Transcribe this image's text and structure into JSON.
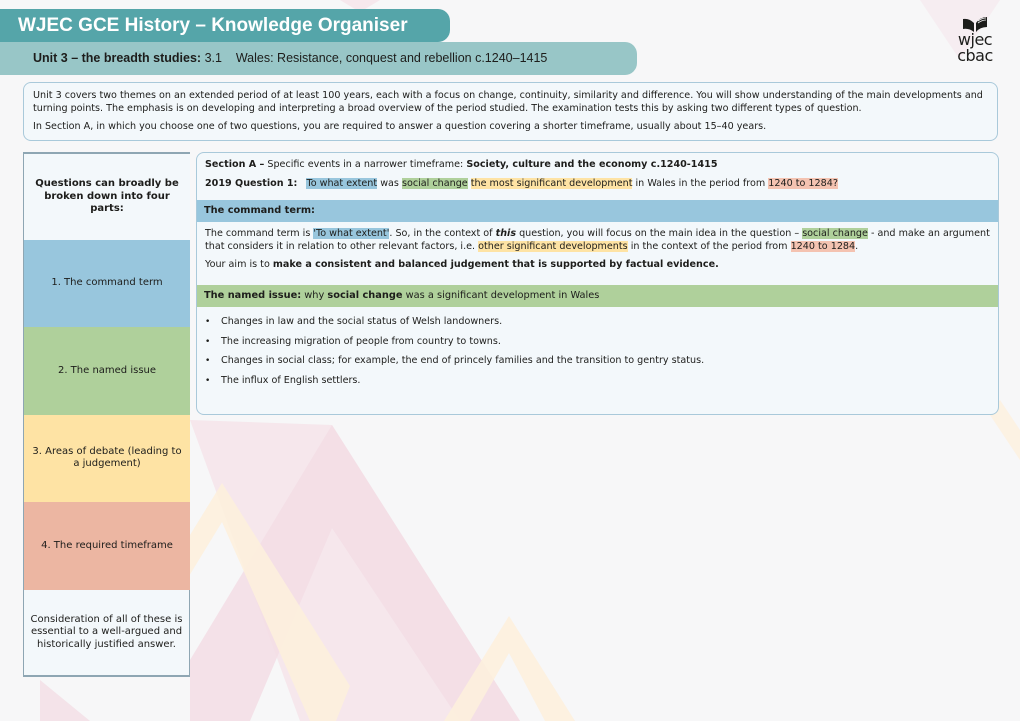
{
  "header": {
    "title": "WJEC GCE History – Knowledge Organiser",
    "subtitle_bold": "Unit 3 – the breadth studies:",
    "subtitle_rest": " 3.1    Wales: Resistance, conquest and rebellion c.1240–1415"
  },
  "logo": {
    "icon": "open-book-icon",
    "line1": "wjec",
    "line2": "cbac"
  },
  "intro": {
    "paragraph1": "Unit 3 covers two themes on an extended period of at least 100 years, each with a focus on change, continuity, similarity and difference. You will show understanding of the main developments and turning points. The emphasis is on developing and interpreting a broad overview of the period studied. The examination tests this by asking two different types of question.",
    "paragraph2": "In Section A, in which you choose one of two questions, you are required to answer a question covering a shorter timeframe, usually about 15–40 years."
  },
  "sidebar": {
    "heading": "Questions can broadly be broken down into four parts:",
    "parts": [
      {
        "label": "1. The command term",
        "color": "#98c6dd"
      },
      {
        "label": "2. The named issue",
        "color": "#afd09b"
      },
      {
        "label": "3. Areas of debate (leading to a judgement)",
        "color": "#fee3a4"
      },
      {
        "label": "4. The required timeframe",
        "color": "#ecb6a2"
      }
    ],
    "footer": "Consideration of all of these is essential to a well-argued and historically justified answer."
  },
  "section_a": {
    "label": "Section A –",
    "description": " Specific events in a narrower timeframe: ",
    "theme": "Society, culture and the economy c.1240-1415",
    "question_label": "2019 Question 1:",
    "question": {
      "command_term": "To what extent",
      "t1": " was ",
      "named_issue": "social change",
      "t2": " ",
      "debate": "the most significant development",
      "t3": " in Wales in the period from ",
      "timeframe": "1240 to 1284?"
    }
  },
  "command_term": {
    "heading": "The command term:",
    "p1": {
      "a": "The command term is ",
      "term": "'To what extent'",
      "b": ". So, in the context of ",
      "this": "this",
      "c": " question, you will focus on the main idea in the question – ",
      "issue": "social change",
      "d": " - and make an argument that considers it in relation to other relevant factors, i.e. ",
      "other": "other significant developments",
      "e": " in the context of the period from ",
      "period": "1240 to 1284",
      "f": "."
    },
    "p2": {
      "a": "Your aim is to ",
      "bold": "make a consistent and balanced judgement that is supported by factual evidence."
    }
  },
  "named_issue": {
    "label": "The named issue:",
    "a": " why ",
    "bold": "social change",
    "b": " was a significant development in Wales",
    "bullets": [
      "Changes in law and the social status of Welsh landowners.",
      "The increasing migration of people from country to towns.",
      "Changes in social class; for example, the end of princely families and the transition to gentry status.",
      "The influx of English settlers."
    ],
    "bullet_glyph": "•"
  }
}
